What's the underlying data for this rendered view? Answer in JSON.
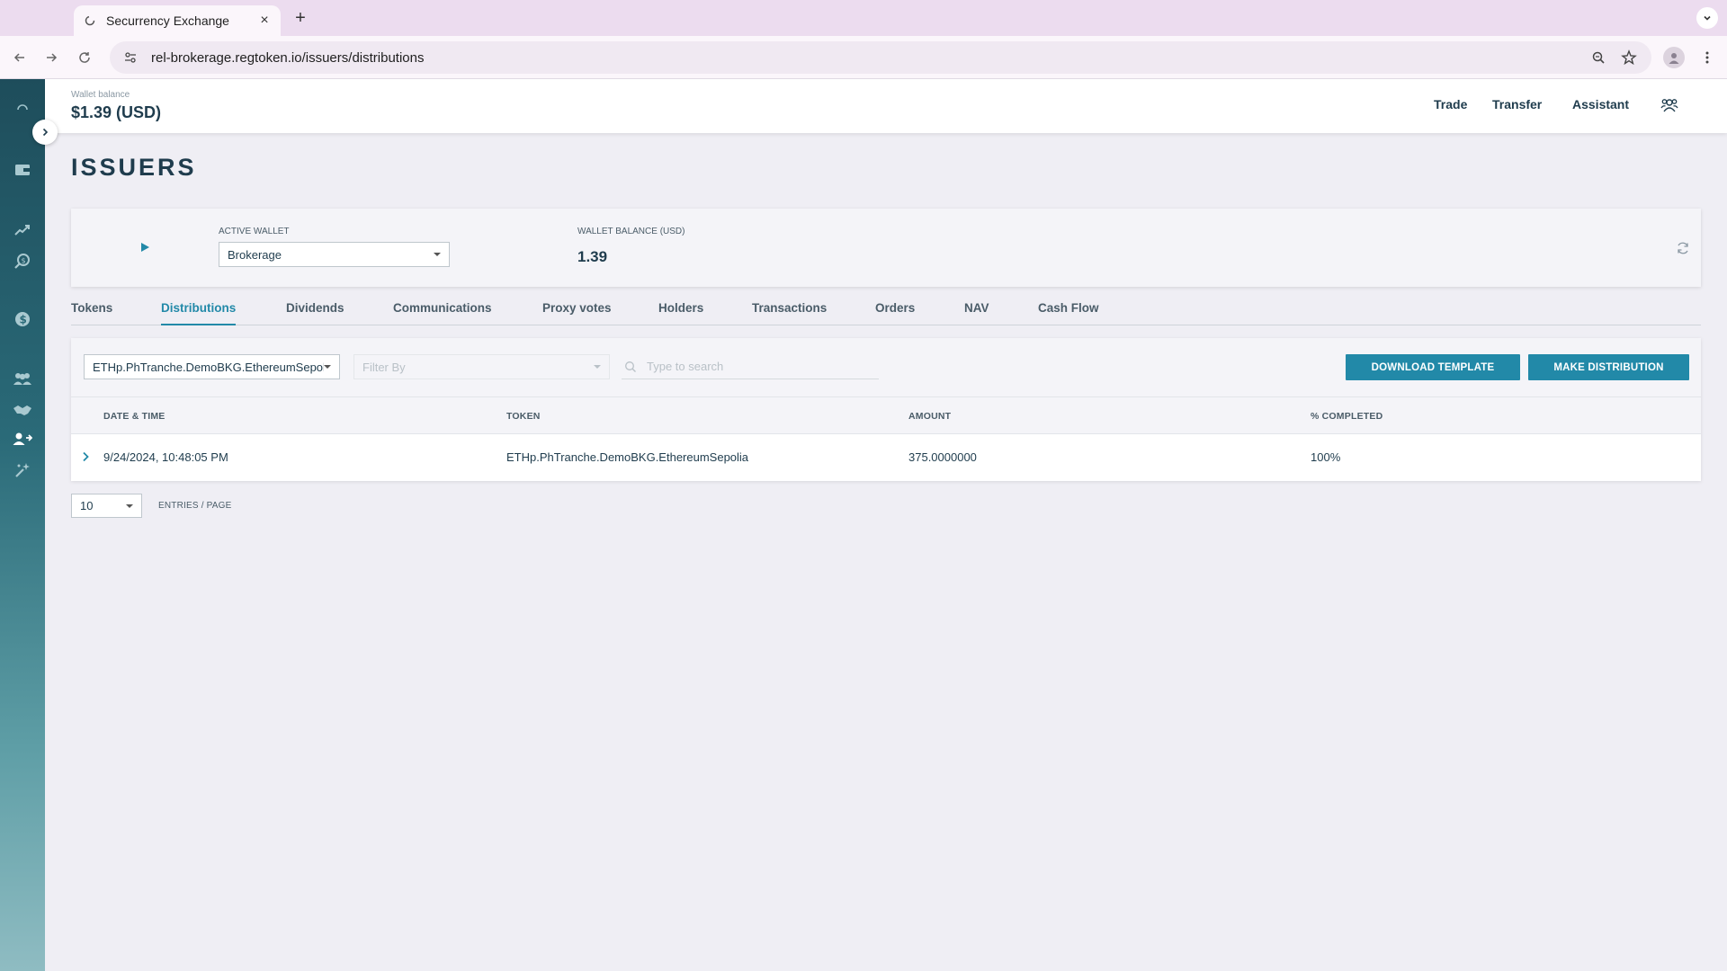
{
  "browser": {
    "tab_title": "Securrency Exchange",
    "url": "rel-brokerage.regtoken.io/issuers/distributions"
  },
  "header": {
    "wallet_balance_label": "Wallet balance",
    "wallet_balance_value": "$1.39 (USD)",
    "nav": [
      "Trade",
      "Transfer",
      "Assistant"
    ]
  },
  "page": {
    "title": "ISSUERS"
  },
  "wallet_card": {
    "active_wallet_label": "ACTIVE WALLET",
    "active_wallet_value": "Brokerage",
    "balance_label": "WALLET BALANCE (USD)",
    "balance_value": "1.39"
  },
  "tabs": [
    "Tokens",
    "Distributions",
    "Dividends",
    "Communications",
    "Proxy votes",
    "Holders",
    "Transactions",
    "Orders",
    "NAV",
    "Cash Flow"
  ],
  "active_tab": "Distributions",
  "toolbar": {
    "token_value": "ETHp.PhTranche.DemoBKG.EthereumSepolia",
    "filter_placeholder": "Filter By",
    "search_placeholder": "Type to search",
    "download_label": "DOWNLOAD TEMPLATE",
    "make_label": "MAKE DISTRIBUTION"
  },
  "table": {
    "headers": [
      "DATE & TIME",
      "TOKEN",
      "AMOUNT",
      "% COMPLETED"
    ],
    "rows": [
      [
        "9/24/2024, 10:48:05 PM",
        "ETHp.PhTranche.DemoBKG.EthereumSepolia",
        "375.0000000",
        "100%"
      ]
    ]
  },
  "pagination": {
    "per_page": "10",
    "label": "ENTRIES / PAGE"
  },
  "colors": {
    "accent": "#2289a8",
    "text_dark": "#1f3c4d",
    "sidebar_top": "#1e4d5b"
  }
}
